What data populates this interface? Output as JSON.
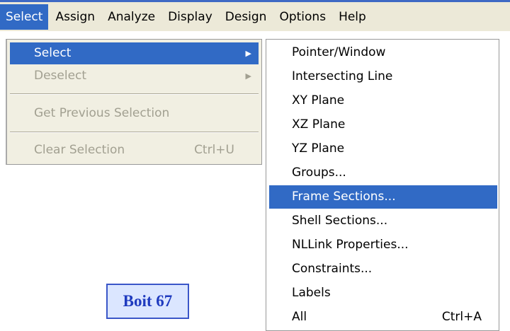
{
  "menubar": {
    "items": [
      "Select",
      "Assign",
      "Analyze",
      "Display",
      "Design",
      "Options",
      "Help"
    ]
  },
  "select_menu": {
    "items": [
      {
        "label": "Select",
        "state": "highlighted",
        "submenu": true
      },
      {
        "label": "Deselect",
        "state": "disabled",
        "submenu": true
      },
      {
        "label": "Get Previous Selection",
        "state": "disabled"
      },
      {
        "label": "Clear Selection",
        "state": "disabled",
        "shortcut": "Ctrl+U"
      }
    ]
  },
  "submenu": {
    "items": [
      {
        "label": "Pointer/Window"
      },
      {
        "label": "Intersecting Line"
      },
      {
        "label": "XY Plane"
      },
      {
        "label": "XZ Plane"
      },
      {
        "label": "YZ Plane"
      },
      {
        "label": "Groups..."
      },
      {
        "label": "Frame Sections...",
        "state": "highlighted"
      },
      {
        "label": "Shell Sections..."
      },
      {
        "label": "NLLink Properties..."
      },
      {
        "label": "Constraints..."
      },
      {
        "label": "Labels"
      },
      {
        "label": "All",
        "shortcut": "Ctrl+A"
      }
    ]
  },
  "caption": {
    "label": "Boit 67"
  },
  "colors": {
    "highlight": "#316ac5",
    "menu_bg": "#ece9d8",
    "caption_text": "#1f3bbf",
    "caption_bg": "#dbe6ff"
  }
}
